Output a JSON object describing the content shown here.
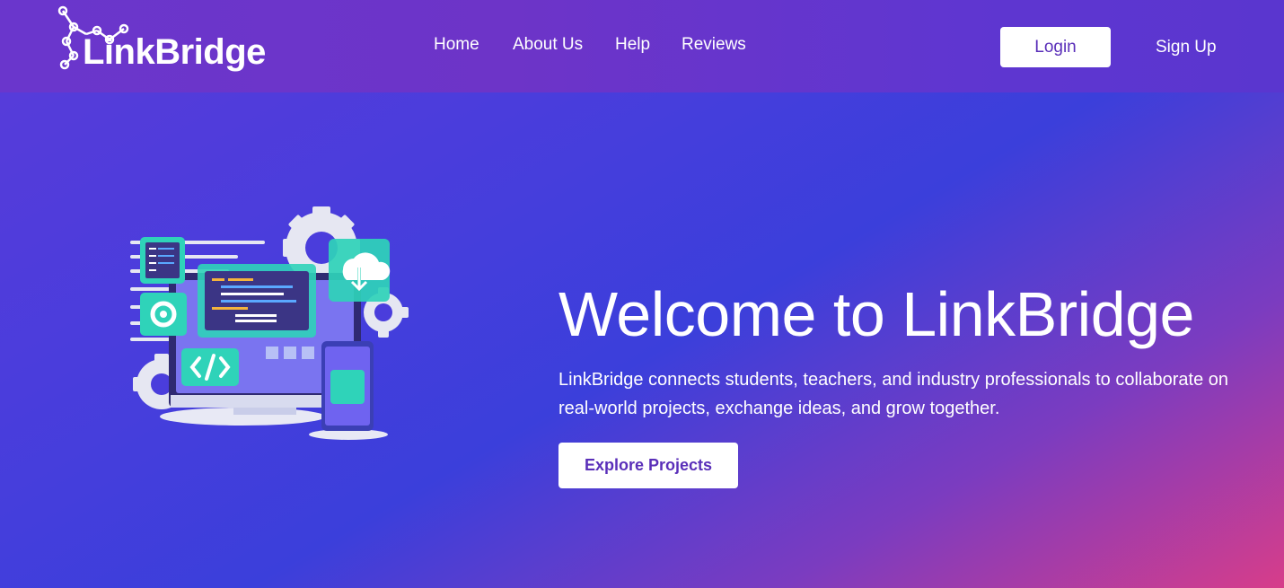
{
  "header": {
    "brand": "LinkBridge",
    "nav": [
      "Home",
      "About Us",
      "Help",
      "Reviews"
    ],
    "login_label": "Login",
    "signup_label": "Sign Up"
  },
  "hero": {
    "title": "Welcome to LinkBridge",
    "description": "LinkBridge connects students, teachers, and industry professionals to collaborate on real-world projects, exchange ideas, and grow together.",
    "cta_label": "Explore Projects"
  },
  "icons": [
    "network-logo-icon",
    "monitor-code-illustration",
    "gear-icon",
    "cloud-download-icon",
    "code-tag-icon",
    "smartphone-icon"
  ],
  "colors": {
    "accent": "#5a2fb9",
    "header": "#6a36cc",
    "gradient_end": "#d73d8a"
  }
}
